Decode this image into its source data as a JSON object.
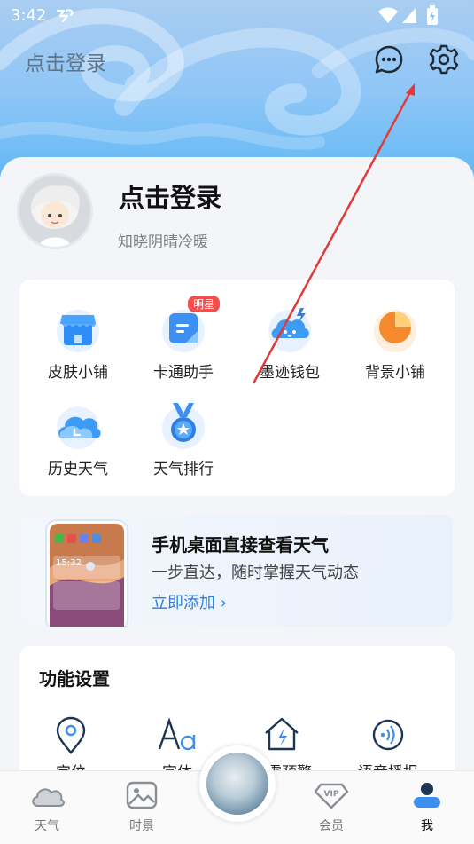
{
  "status": {
    "time": "3:42"
  },
  "header": {
    "title": "点击登录"
  },
  "profile": {
    "name": "点击登录",
    "subtitle": "知晓阴晴冷暖"
  },
  "services": [
    {
      "label": "皮肤小铺",
      "icon": "shop-icon"
    },
    {
      "label": "卡通助手",
      "icon": "cartoon-assistant-icon",
      "badge": "明星"
    },
    {
      "label": "墨迹钱包",
      "icon": "wallet-icon"
    },
    {
      "label": "背景小铺",
      "icon": "background-shop-icon"
    },
    {
      "label": "历史天气",
      "icon": "history-weather-icon"
    },
    {
      "label": "天气排行",
      "icon": "weather-ranking-icon"
    }
  ],
  "promo": {
    "title": "手机桌面直接查看天气",
    "subtitle": "一步直达，随时掌握天气动态",
    "link": "立即添加 ›",
    "phone_time": "15:32"
  },
  "settings": {
    "title": "功能设置",
    "items": [
      {
        "label": "定位",
        "icon": "location-icon"
      },
      {
        "label": "字体",
        "icon": "font-icon"
      },
      {
        "label": "地震预警",
        "icon": "earthquake-warning-icon"
      },
      {
        "label": "语音播报",
        "icon": "voice-broadcast-icon"
      }
    ]
  },
  "bottom_nav": [
    {
      "label": "天气",
      "icon": "cloud-icon"
    },
    {
      "label": "时景",
      "icon": "picture-icon"
    },
    {
      "label": "会员",
      "icon": "vip-icon"
    },
    {
      "label": "我",
      "icon": "user-icon",
      "active": true
    }
  ],
  "colors": {
    "accent": "#2a7de1",
    "badge": "#f24e4e",
    "hero_top": "#a9cdf2",
    "hero_bottom": "#56b5f4"
  }
}
